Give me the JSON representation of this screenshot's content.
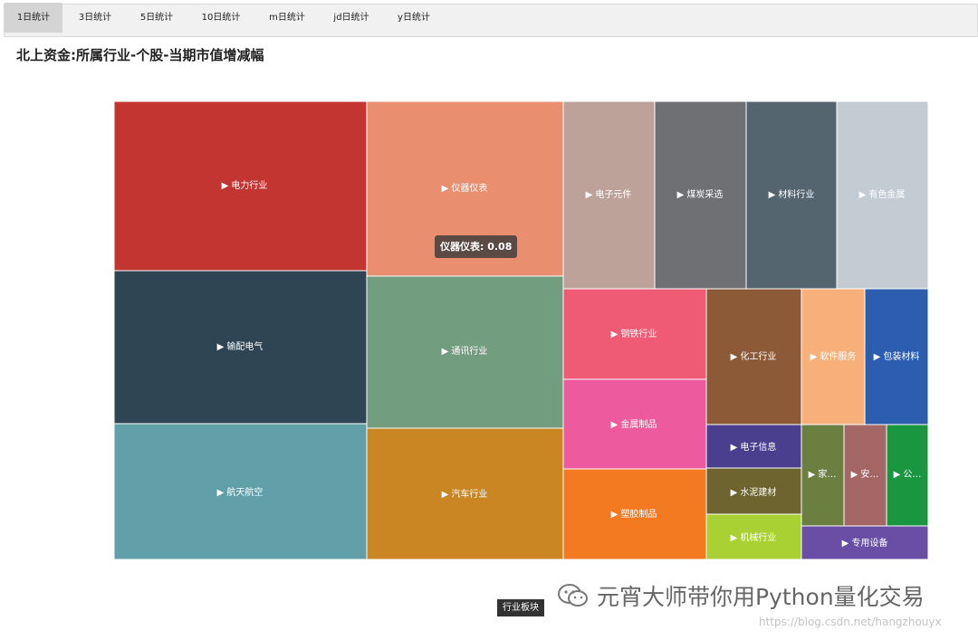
{
  "tabs": [
    {
      "label": "1日统计",
      "active": true
    },
    {
      "label": "3日统计"
    },
    {
      "label": "5日统计"
    },
    {
      "label": "10日统计"
    },
    {
      "label": "m日统计"
    },
    {
      "label": "jd日统计"
    },
    {
      "label": "y日统计"
    }
  ],
  "page_title": "北上资金:所属行业-个股-当期市值增减幅",
  "treemap_items": [
    {
      "label": "▶ 电力行业",
      "color": "#c23531"
    },
    {
      "label": "▶ 仪器仪表",
      "color": "#e98f6f"
    },
    {
      "label": "▶ 电子元件",
      "color": "#bda29a"
    },
    {
      "label": "▶ 煤炭采选",
      "color": "#6e7074"
    },
    {
      "label": "▶ 材料行业",
      "color": "#546570"
    },
    {
      "label": "▶ 有色金属",
      "color": "#c4ccd3"
    },
    {
      "label": "▶ 输配电气",
      "color": "#2f4554"
    },
    {
      "label": "▶ 通讯行业",
      "color": "#729e7f"
    },
    {
      "label": "▶ 钢铁行业",
      "color": "#ef5b75"
    },
    {
      "label": "▶ 化工行业",
      "color": "#8d5a38"
    },
    {
      "label": "▶ 软件服务",
      "color": "#f8b07a"
    },
    {
      "label": "▶ 包装材料",
      "color": "#2c5daf"
    },
    {
      "label": "▶ 金属制品",
      "color": "#ee5a9e"
    },
    {
      "label": "▶ 航天航空",
      "color": "#61a0a8"
    },
    {
      "label": "▶ 汽车行业",
      "color": "#ca8622"
    },
    {
      "label": "▶ 电子信息",
      "color": "#4a3f8e"
    },
    {
      "label": "▶ 家…",
      "color": "#6b8040"
    },
    {
      "label": "▶ 安…",
      "color": "#a56766"
    },
    {
      "label": "▶ 公…",
      "color": "#1a9641"
    },
    {
      "label": "▶ 塑胶制品",
      "color": "#f47a22"
    },
    {
      "label": "▶ 水泥建材",
      "color": "#6e6430"
    },
    {
      "label": "▶ 机械行业",
      "color": "#a9d134"
    },
    {
      "label": "▶ 专用设备",
      "color": "#6a4ea5"
    }
  ],
  "tooltip": {
    "text": "仪器仪表: 0.08"
  },
  "breadcrumb": {
    "label": "行业板块"
  },
  "watermark": {
    "text": "元宵大师带你用Python量化交易",
    "url": "https://blog.csdn.net/hangzhouyx",
    "icon": "wechat-icon"
  }
}
